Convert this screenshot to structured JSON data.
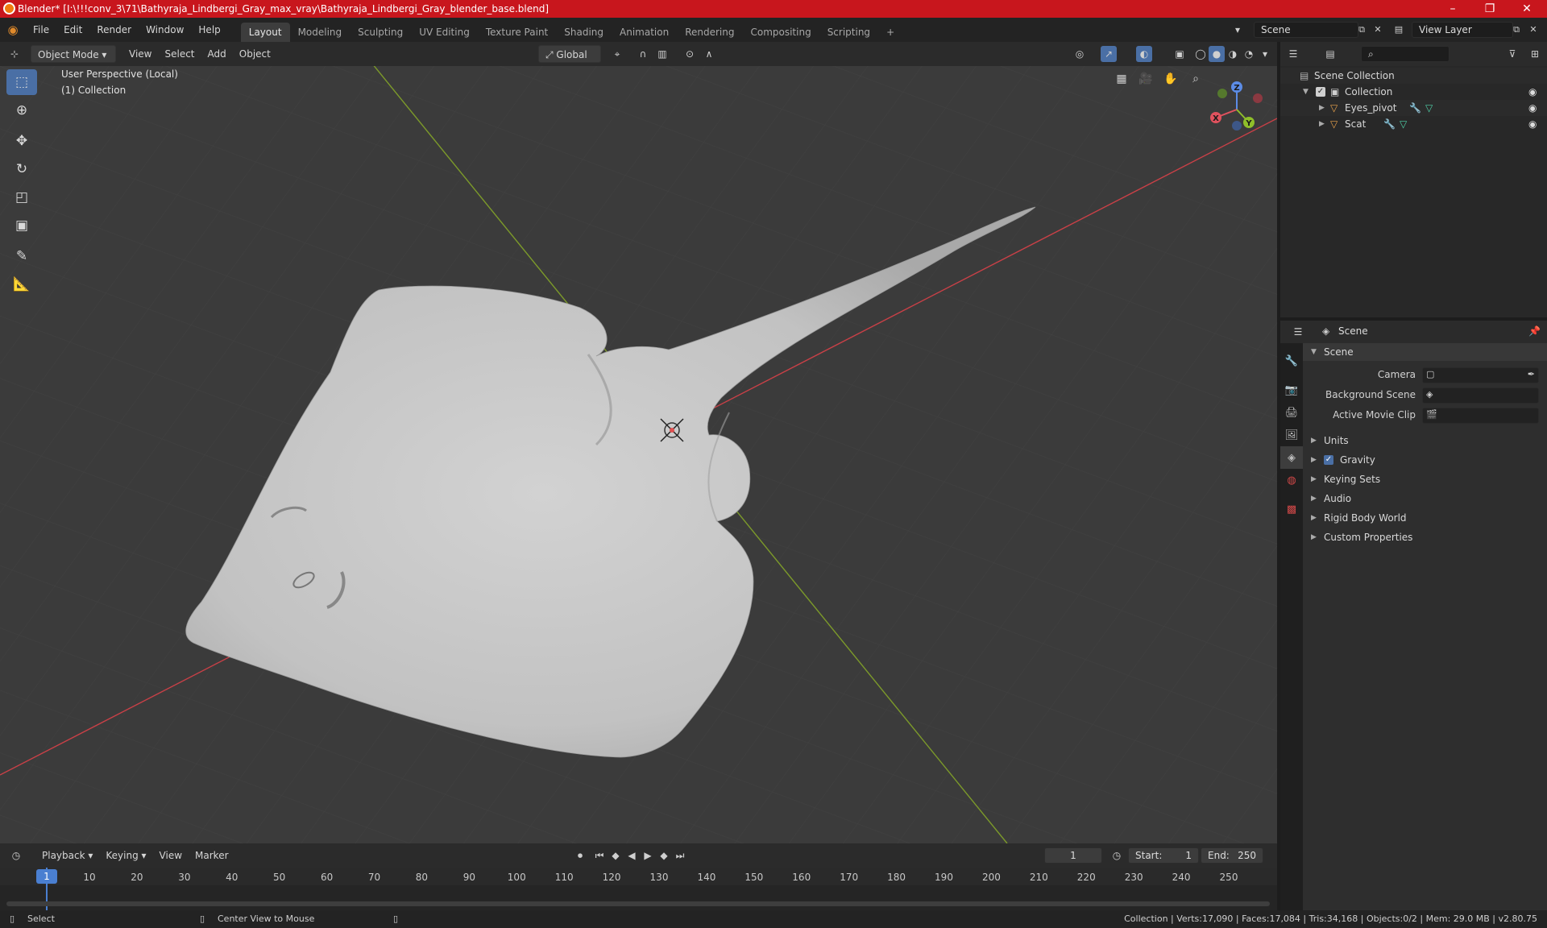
{
  "window": {
    "title": "Blender* [I:\\!!!conv_3\\71\\Bathyraja_Lindbergi_Gray_max_vray\\Bathyraja_Lindbergi_Gray_blender_base.blend]",
    "minimize": "–",
    "maximize": "❐",
    "close": "✕"
  },
  "menubar": {
    "menus": [
      "File",
      "Edit",
      "Render",
      "Window",
      "Help"
    ],
    "workspaces": [
      "Layout",
      "Modeling",
      "Sculpting",
      "UV Editing",
      "Texture Paint",
      "Shading",
      "Animation",
      "Rendering",
      "Compositing",
      "Scripting"
    ],
    "active_workspace": "Layout",
    "add_workspace": "+",
    "scene": "Scene",
    "view_layer": "View Layer"
  },
  "viewport_header": {
    "mode": "Object Mode",
    "menus": [
      "View",
      "Select",
      "Add",
      "Object"
    ],
    "transform_orientation": "Global"
  },
  "viewport": {
    "perspective": "User Perspective (Local)",
    "collection": "(1) Collection",
    "gizmo": {
      "z": "Z",
      "x": "X",
      "y": "Y"
    }
  },
  "outliner": {
    "rows": [
      {
        "label": "Scene Collection",
        "type": "scene-collection"
      },
      {
        "label": "Collection",
        "type": "collection"
      },
      {
        "label": "Eyes_pivot",
        "type": "object"
      },
      {
        "label": "Scat",
        "type": "object"
      }
    ]
  },
  "properties": {
    "context": "Scene",
    "panel_title": "Scene",
    "fields": [
      {
        "label": "Camera"
      },
      {
        "label": "Background Scene"
      },
      {
        "label": "Active Movie Clip"
      }
    ],
    "sections": [
      "Units",
      "Gravity",
      "Keying Sets",
      "Audio",
      "Rigid Body World",
      "Custom Properties"
    ],
    "gravity_checked": true
  },
  "timeline": {
    "menus": [
      "Playback",
      "Keying",
      "View",
      "Marker"
    ],
    "current_frame": "1",
    "start_label": "Start:",
    "start": "1",
    "end_label": "End:",
    "end": "250",
    "ticks": [
      1,
      10,
      20,
      30,
      40,
      50,
      60,
      70,
      80,
      90,
      100,
      110,
      120,
      130,
      140,
      150,
      160,
      170,
      180,
      190,
      200,
      210,
      220,
      230,
      240,
      250
    ]
  },
  "statusbar": {
    "left": "Select",
    "middle": "Center View to Mouse",
    "stats": "Collection | Verts:17,090 | Faces:17,084 | Tris:34,168 | Objects:0/2 | Mem: 29.0 MB | v2.80.75"
  },
  "colors": {
    "title_bar": "#c8161d",
    "accent_blue": "#4a6fa5",
    "x_axis": "#c94047",
    "y_axis": "#7c9a2a",
    "mesh": "#c9c9c9"
  }
}
